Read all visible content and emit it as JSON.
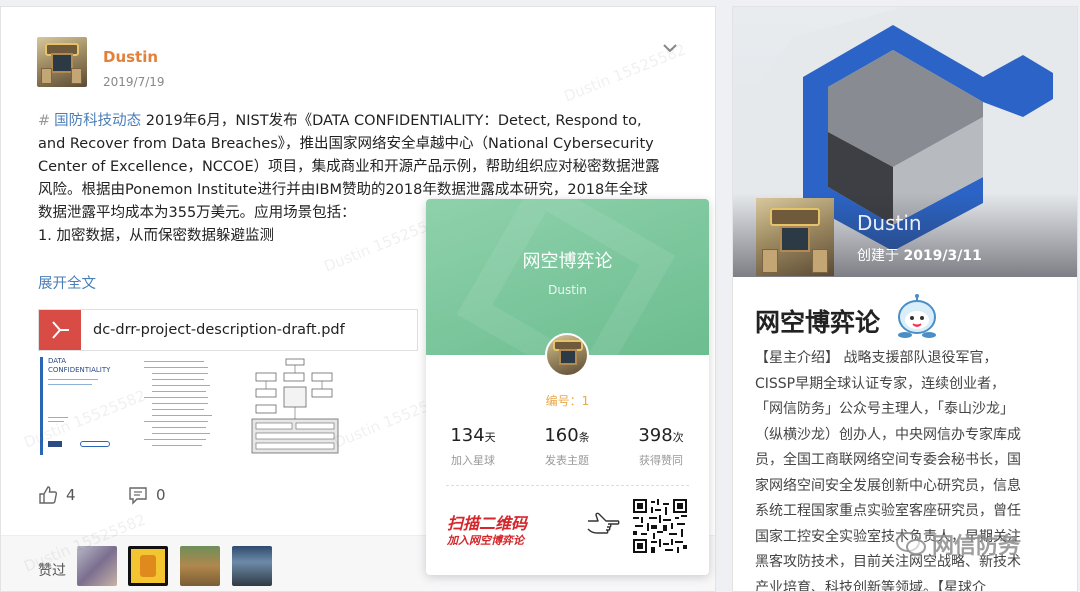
{
  "post": {
    "author": "Dustin",
    "date": "2019/7/19",
    "tag": "国防科技动态",
    "lines": [
      "2019年6月，NIST发布《DATA CONFIDENTIALITY：Detect, Respond to,",
      "and Recover from Data Breaches》，推出国家网络安全卓越中心（National Cybersecurity",
      "Center of Excellence，NCCOE）项目，集成商业和开源产品示例，帮助组织应对秘密数据泄露",
      "风险。根据由Ponemon Institute进行并由IBM赞助的2018年数据泄露成本研究，2018年全球",
      "数据泄露平均成本为355万美元。应用场景包括：",
      "1. 加密数据，从而保密数据躲避监测"
    ],
    "expand_label": "展开全文",
    "attachment": {
      "file_name": "dc-drr-project-description-draft.pdf",
      "thumb_title_1": "DATA",
      "thumb_title_2": "CONFIDENTIALITY"
    },
    "likes_count": "4",
    "comments_count": "0",
    "likers_label": "赞过"
  },
  "watermark_text": "Dustin 15525582",
  "planet_card": {
    "name": "网空博弈论",
    "owner": "Dustin",
    "number_label": "编号：1",
    "stats": [
      {
        "value": "134",
        "unit": "天",
        "label": "加入星球"
      },
      {
        "value": "160",
        "unit": "条",
        "label": "发表主题"
      },
      {
        "value": "398",
        "unit": "次",
        "label": "获得赞同"
      }
    ],
    "scan_title": "扫描二维码",
    "scan_subtitle": "加入网空博弈论"
  },
  "info_panel": {
    "owner": "Dustin",
    "created_label": "创建于",
    "created_date": "2019/3/11",
    "title": "网空博弈论",
    "description_lines": [
      "【星主介绍】 战略支援部队退役军官，",
      "CISSP早期全球认证专家，连续创业者，",
      "「网信防务」公众号主理人，「泰山沙龙」",
      "（纵横沙龙）创办人，中央网信办专家库成",
      "员，全国工商联网络空间专委会秘书长，国",
      "家网络空间安全发展创新中心研究员，信息",
      "系统工程国家重点实验室客座研究员，曾任",
      "国家工控安全实验室技术负责人，早期关注",
      "黑客攻防技术，目前关注网空战略、新技术",
      "产业培育、科技创新等领域。【星球介"
    ]
  },
  "brand_watermark": "网信防务",
  "colors": {
    "accent_orange": "#e3803a",
    "link_blue": "#4a7eb7",
    "planet_green": "#72c295",
    "qr_red": "#d4262b",
    "banner_blue": "#2b64c6"
  }
}
